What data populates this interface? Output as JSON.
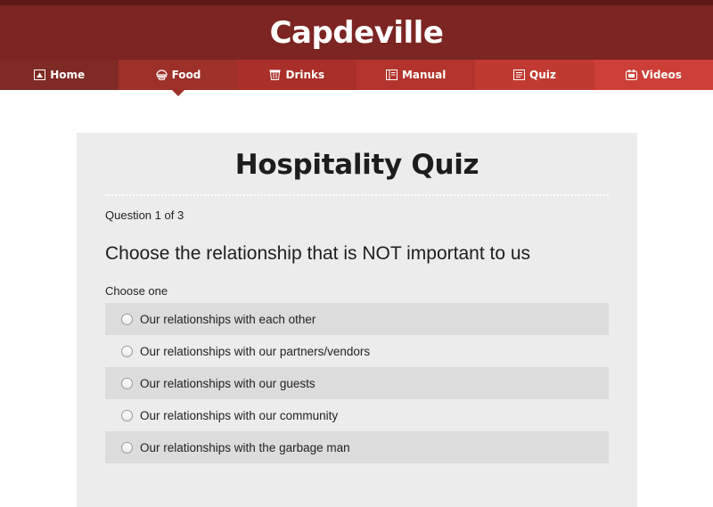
{
  "header": {
    "title": "Capdeville"
  },
  "nav": {
    "items": [
      {
        "label": "Home",
        "icon": "home-icon",
        "color": "#7f2a24"
      },
      {
        "label": "Food",
        "icon": "food-icon",
        "color": "#9d3028",
        "active": true
      },
      {
        "label": "Drinks",
        "icon": "drinks-icon",
        "color": "#a92f28"
      },
      {
        "label": "Manual",
        "icon": "manual-icon",
        "color": "#b3342c"
      },
      {
        "label": "Quiz",
        "icon": "quiz-icon",
        "color": "#c13a31"
      },
      {
        "label": "Videos",
        "icon": "videos-icon",
        "color": "#cc3f36"
      }
    ]
  },
  "quiz": {
    "title": "Hospitality Quiz",
    "progress": "Question 1 of 3",
    "question": "Choose the relationship that is NOT important to us",
    "hint": "Choose one",
    "options": [
      "Our relationships with each other",
      "Our relationships with our partners/vendors",
      "Our relationships with our guests",
      "Our relationships with our community",
      "Our relationships with the garbage man"
    ]
  },
  "colors": {
    "header_bg": "#7c2523",
    "top_strip": "#5e1a18",
    "card_bg": "#ececec",
    "option_shade": "#dcdcdc"
  }
}
